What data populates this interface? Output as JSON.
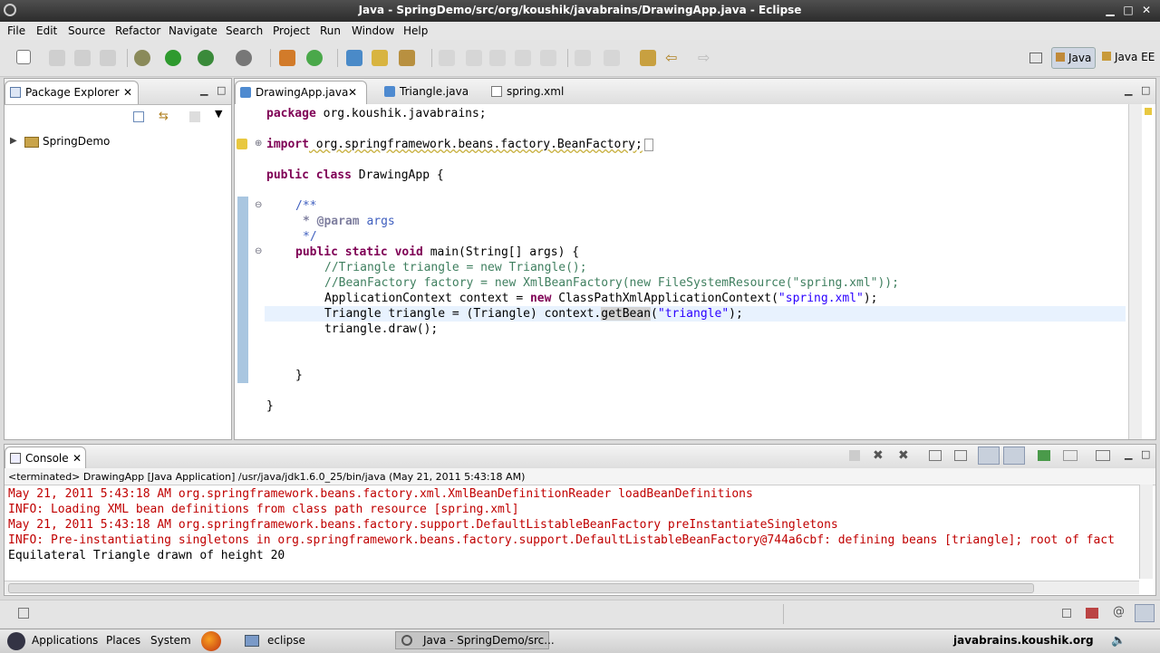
{
  "window": {
    "title": "Java - SpringDemo/src/org/koushik/javabrains/DrawingApp.java - Eclipse"
  },
  "menus": [
    "File",
    "Edit",
    "Source",
    "Refactor",
    "Navigate",
    "Search",
    "Project",
    "Run",
    "Window",
    "Help"
  ],
  "perspectives": {
    "java": "Java",
    "javaee": "Java EE"
  },
  "package_explorer": {
    "title": "Package Explorer",
    "project": "SpringDemo"
  },
  "editor": {
    "tabs": [
      "DrawingApp.java",
      "Triangle.java",
      "spring.xml"
    ],
    "lines": {
      "l1_kw": "package",
      "l1_rest": " org.koushik.javabrains;",
      "l2_kw": "import",
      "l2_rest": " org.springframework.beans.factory.BeanFactory;",
      "l3_kw": "public class",
      "l3_rest": " DrawingApp {",
      "l4": "/**",
      "l5_tag": "* @param",
      "l5_rest": " args",
      "l6": "*/",
      "l7_kw": "public static void",
      "l7_rest": " main(String[] args) {",
      "l8": "//Triangle triangle = new Triangle();",
      "l9": "//BeanFactory factory = new XmlBeanFactory(new FileSystemResource(\"spring.xml\"));",
      "l10_a": "ApplicationContext context = ",
      "l10_kw": "new",
      "l10_b": " ClassPathXmlApplicationContext(",
      "l10_str": "\"spring.xml\"",
      "l10_c": ");",
      "l11_a": "Triangle triangle = (Triangle) context.",
      "l11_hl": "getBean",
      "l11_b": "(",
      "l11_str": "\"triangle\"",
      "l11_c": ");",
      "l12": "triangle.draw();",
      "l13": "}",
      "l14": "}"
    }
  },
  "console": {
    "title": "Console",
    "terminated": "<terminated> DrawingApp [Java Application] /usr/java/jdk1.6.0_25/bin/java (May 21, 2011 5:43:18 AM)",
    "lines": [
      "May 21, 2011 5:43:18 AM org.springframework.beans.factory.xml.XmlBeanDefinitionReader loadBeanDefinitions",
      "INFO: Loading XML bean definitions from class path resource [spring.xml]",
      "May 21, 2011 5:43:18 AM org.springframework.beans.factory.support.DefaultListableBeanFactory preInstantiateSingletons",
      "INFO: Pre-instantiating singletons in org.springframework.beans.factory.support.DefaultListableBeanFactory@744a6cbf: defining beans [triangle]; root of fact",
      "Equilateral Triangle drawn of height 20"
    ]
  },
  "taskbar": {
    "applications": "Applications",
    "places": "Places",
    "system": "System",
    "eclipse": "eclipse",
    "active_window": "Java - SpringDemo/src...",
    "site": "javabrains.koushik.org"
  }
}
